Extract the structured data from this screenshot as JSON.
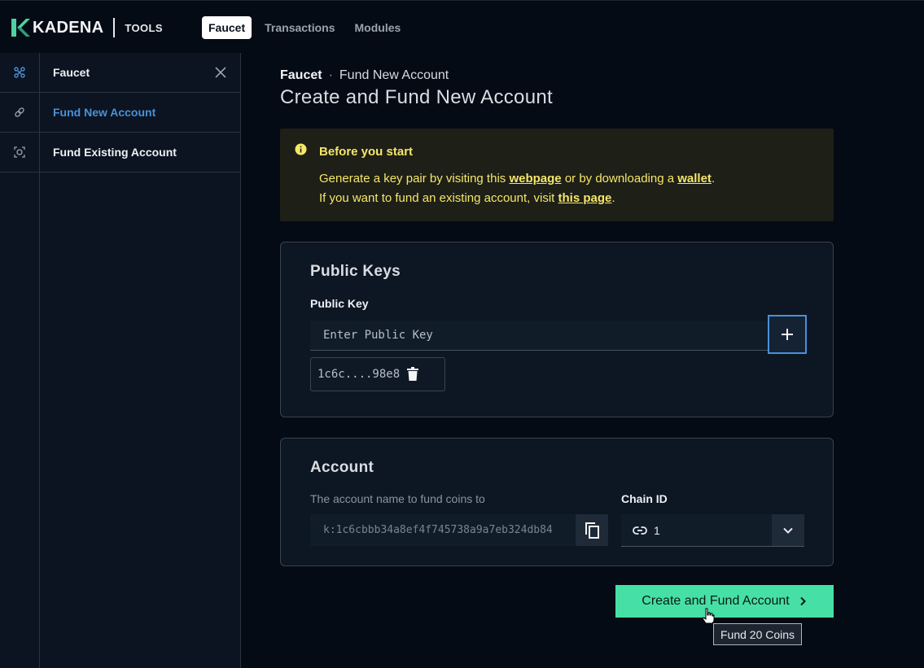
{
  "brand": {
    "name": "KADENA",
    "product": "TOOLS"
  },
  "topnav": {
    "items": [
      {
        "label": "Faucet",
        "active": true
      },
      {
        "label": "Transactions",
        "active": false
      },
      {
        "label": "Modules",
        "active": false
      }
    ]
  },
  "rail": {
    "icons": [
      "faucet-icon",
      "fund-new-account-icon",
      "fund-existing-account-icon"
    ]
  },
  "sidebar": {
    "title": "Faucet",
    "items": [
      {
        "label": "Fund New Account",
        "active": true
      },
      {
        "label": "Fund Existing Account",
        "active": false
      }
    ]
  },
  "breadcrumb": {
    "root": "Faucet",
    "separator": "·",
    "current": "Fund New Account"
  },
  "page_title": "Create and Fund New Account",
  "notice": {
    "title": "Before you start",
    "line1_prefix": "Generate a key pair by visiting this",
    "line1_link1": "webpage",
    "line1_middle": "or by downloading a",
    "line1_link2": "wallet",
    "line1_suffix": ".",
    "line2_prefix": "If you want to fund an existing account, visit",
    "line2_link": "this page",
    "line2_suffix": "."
  },
  "public_keys": {
    "title": "Public Keys",
    "field_label": "Public Key",
    "placeholder": "Enter Public Key",
    "keys": [
      "1c6c....98e8"
    ]
  },
  "account": {
    "title": "Account",
    "name_label": "The account name to fund coins to",
    "name_value": "k:1c6cbbb34a8ef4f745738a9a7eb324db84",
    "chain_label": "Chain ID",
    "chain_value": "1"
  },
  "submit": {
    "label": "Create and Fund Account",
    "tooltip": "Fund 20 Coins"
  },
  "colors": {
    "accent": "#4a90d9",
    "primary_button": "#46e0a6",
    "notice_text": "#f5e76a",
    "notice_bg": "#1e1f17",
    "background": "#050b14"
  }
}
